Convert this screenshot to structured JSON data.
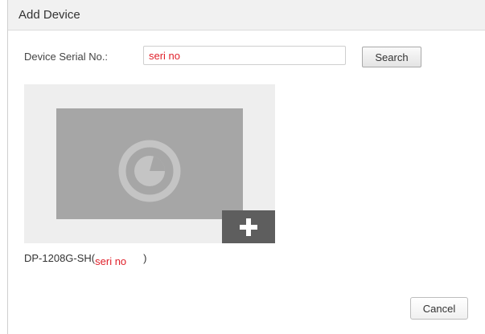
{
  "dialog": {
    "title": "Add Device"
  },
  "search": {
    "label": "Device Serial No.:",
    "value": "seri no",
    "button_label": "Search"
  },
  "result": {
    "thumbnail_icon": "camera-lens-icon",
    "add_icon": "plus-icon",
    "model": "DP-1208G-SH(",
    "serial": "seri no",
    "close_paren": ")"
  },
  "footer": {
    "cancel_label": "Cancel"
  },
  "colors": {
    "accent_text": "#e0202a",
    "titlebar_bg": "#f1f1f1",
    "card_bg": "#eeeeee",
    "thumb_bg": "#a6a6a6",
    "add_button_bg": "#5e5e5e"
  }
}
